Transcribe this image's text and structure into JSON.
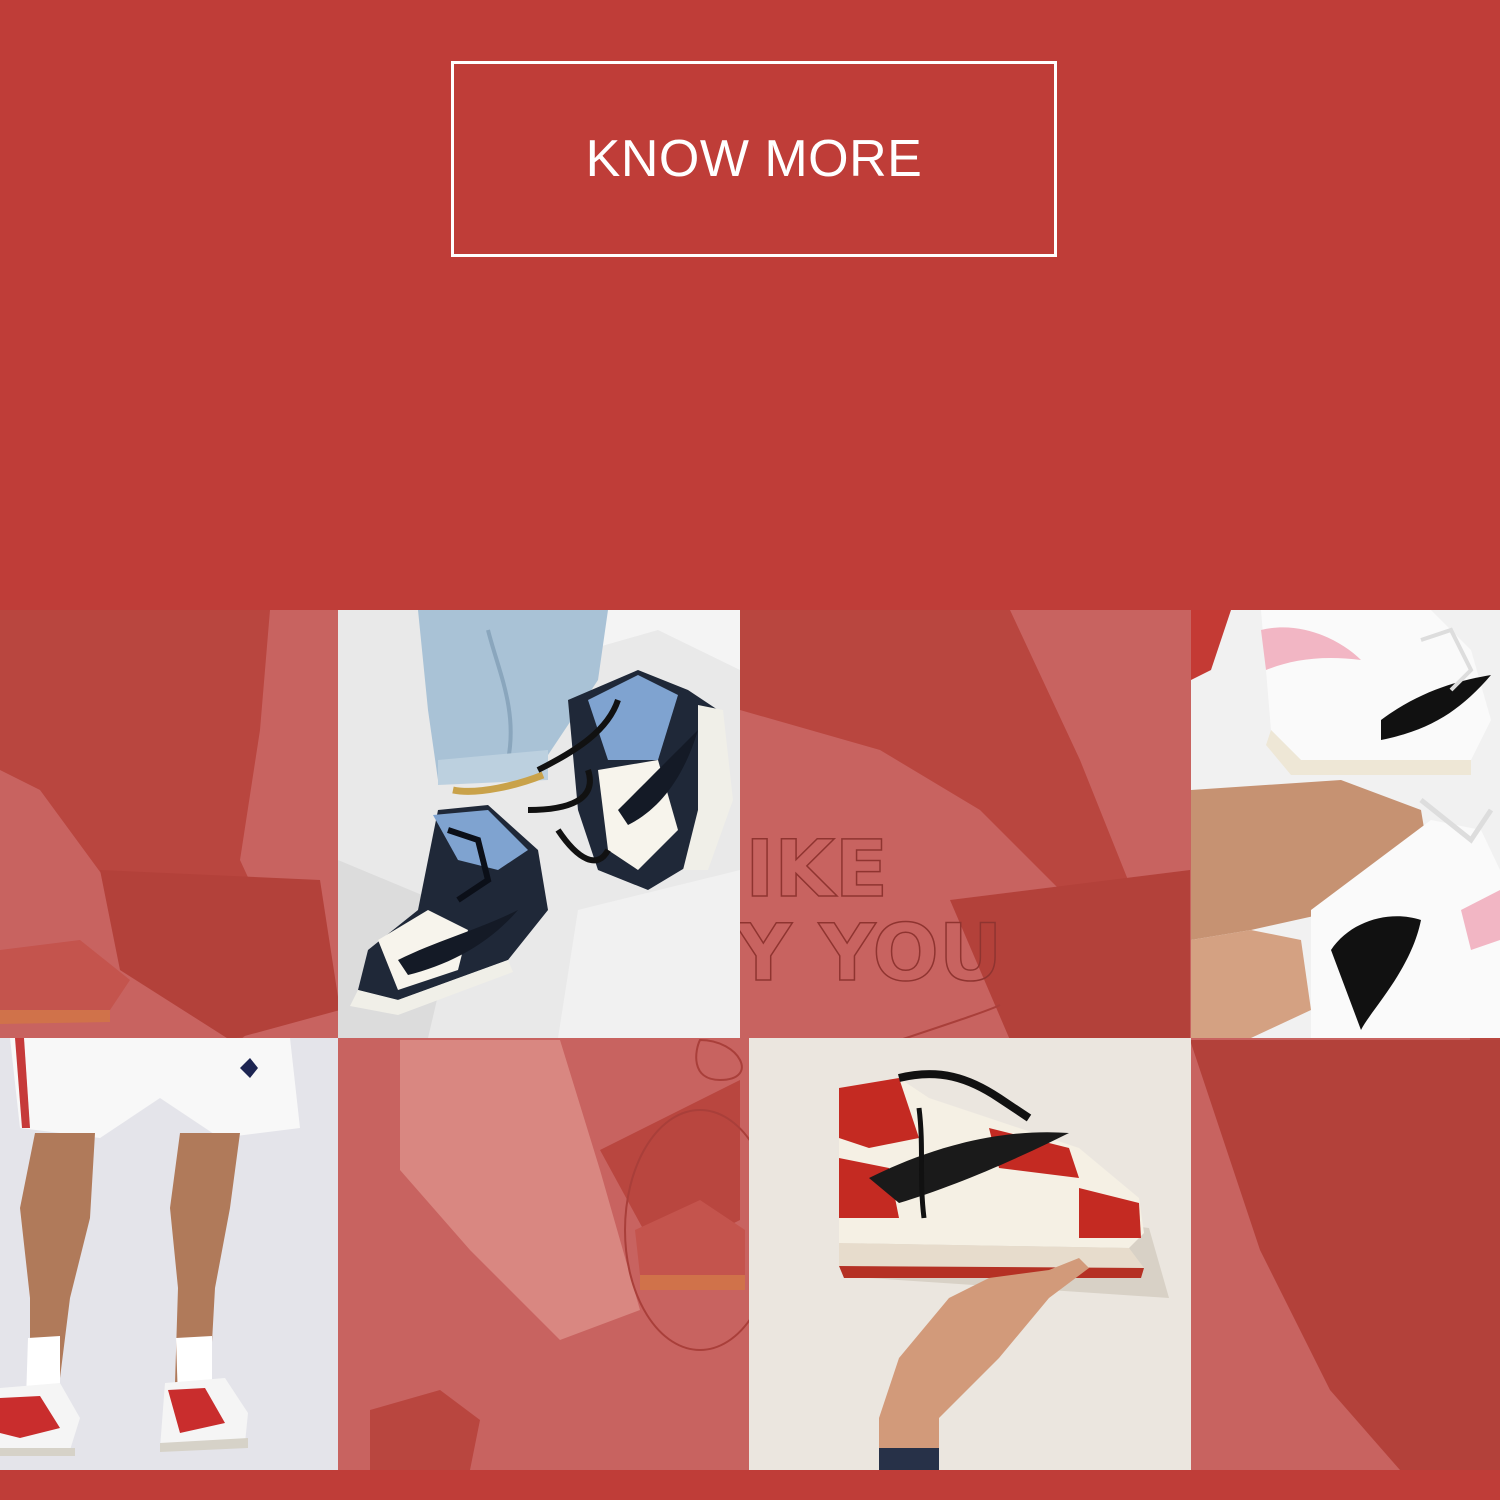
{
  "hero": {
    "cta_label": "KNOW MORE"
  },
  "collage": {
    "watermark_line1": "NIKE",
    "watermark_line2": "BY YOU",
    "tiles": [
      {
        "subject": "legs-with-jordan-sneakers"
      },
      {
        "subject": "blue-black-high-top-sneakers-on-bed"
      },
      {
        "subject": "white-pink-high-top-sneakers"
      },
      {
        "subject": "white-shorts-red-sneakers"
      },
      {
        "subject": "red-white-high-top-sneaker-in-hand"
      }
    ]
  },
  "colors": {
    "background": "#bf3d38",
    "collage_tint": "#c86360",
    "button_border": "#ffffff",
    "button_text": "#ffffff"
  }
}
